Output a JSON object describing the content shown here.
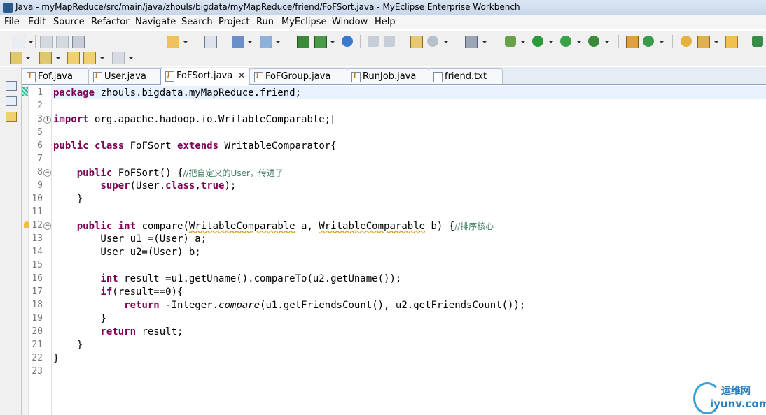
{
  "window": {
    "title": "Java - myMapReduce/src/main/java/zhouls/bigdata/myMapReduce/friend/FoFSort.java - MyEclipse Enterprise Workbench"
  },
  "menu": [
    "File",
    "Edit",
    "Source",
    "Refactor",
    "Navigate",
    "Search",
    "Project",
    "Run",
    "MyEclipse",
    "Window",
    "Help"
  ],
  "tabs": [
    {
      "label": "Fof.java",
      "icon": "java-file-icon",
      "active": false
    },
    {
      "label": "User.java",
      "icon": "java-file-icon",
      "active": false
    },
    {
      "label": "FoFSort.java",
      "icon": "java-file-icon",
      "active": true,
      "close": "✕"
    },
    {
      "label": "FoFGroup.java",
      "icon": "java-file-icon",
      "active": false
    },
    {
      "label": "RunJob.java",
      "icon": "java-file-icon",
      "active": false
    },
    {
      "label": "friend.txt",
      "icon": "text-file-icon",
      "active": false
    }
  ],
  "editor": {
    "line_numbers": [
      "1",
      "2",
      "3",
      "5",
      "6",
      "7",
      "8",
      "9",
      "10",
      "11",
      "12",
      "13",
      "14",
      "15",
      "16",
      "17",
      "18",
      "19",
      "20",
      "21",
      "22",
      "23"
    ]
  },
  "watermark": {
    "cn": "运维网",
    "en": "iyunv.com"
  },
  "colors": {
    "keyword": "#7f0055",
    "comment": "#3f7f5f",
    "current_line": "#e8f2fe"
  }
}
